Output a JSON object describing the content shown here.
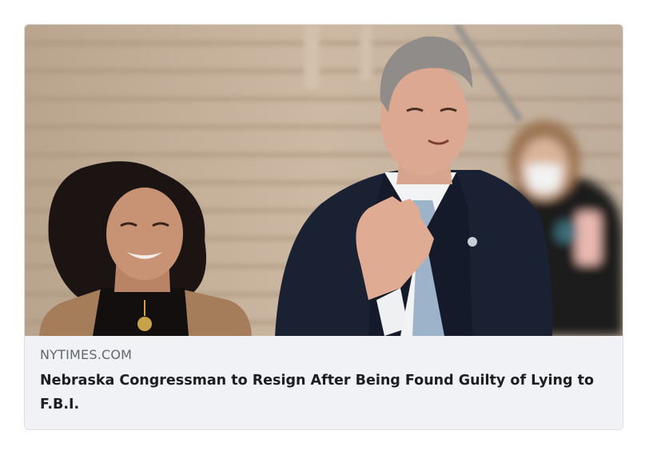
{
  "link_preview": {
    "domain": "NYTIMES.COM",
    "headline": "Nebraska Congressman to Resign After Being Found Guilty of Lying to F.B.I.",
    "image_subject": "photo-of-congressman-waving"
  }
}
